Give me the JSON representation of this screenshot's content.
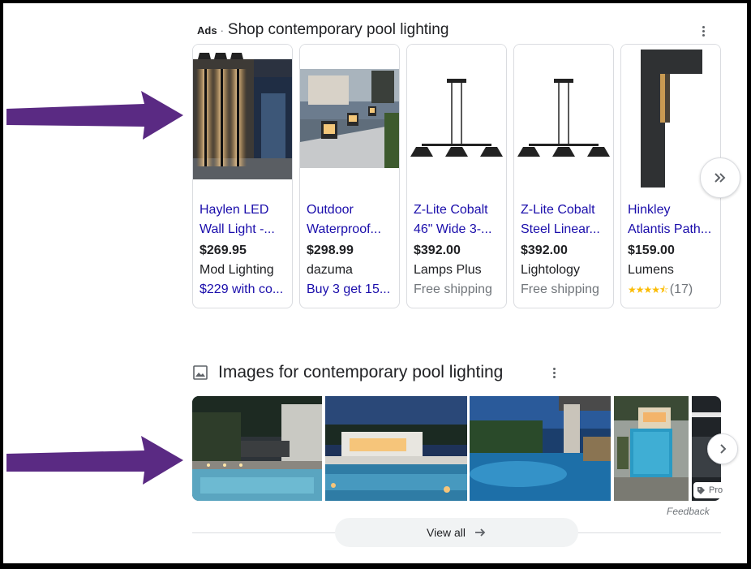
{
  "ads": {
    "label": "Ads",
    "separator": "·",
    "title": "Shop contemporary pool lighting"
  },
  "products": [
    {
      "name_line1": "Haylen LED",
      "name_line2": "Wall Light -...",
      "price": "$269.95",
      "store": "Mod Lighting",
      "extra": "$229 with co...",
      "extra_style": "link"
    },
    {
      "name_line1": "Outdoor",
      "name_line2": "Waterproof...",
      "price": "$298.99",
      "store": "dazuma",
      "extra": "Buy 3 get 15...",
      "extra_style": "link"
    },
    {
      "name_line1": "Z-Lite Cobalt",
      "name_line2": "46\" Wide 3-...",
      "price": "$392.00",
      "store": "Lamps Plus",
      "extra": "Free shipping",
      "extra_style": "gray"
    },
    {
      "name_line1": "Z-Lite Cobalt",
      "name_line2": "Steel Linear...",
      "price": "$392.00",
      "store": "Lightology",
      "extra": "Free shipping",
      "extra_style": "gray"
    },
    {
      "name_line1": "Hinkley",
      "name_line2": "Atlantis Path...",
      "price": "$159.00",
      "store": "Lumens",
      "rating": 4.5,
      "rating_count": "(17)",
      "extra_style": "rating"
    }
  ],
  "images_section": {
    "title": "Images for contemporary pool lighting",
    "tag_text": "Pro",
    "feedback": "Feedback",
    "view_all": "View all"
  },
  "colors": {
    "link": "#1a0dab",
    "text": "#202124",
    "muted": "#70757a",
    "star": "#fbbc04",
    "arrow": "#5a2a83"
  },
  "icons": [
    "kebab-menu-icon",
    "double-chevron-right-icon",
    "image-icon",
    "chevron-right-icon",
    "arrow-right-icon",
    "tag-icon",
    "purple-arrow"
  ]
}
